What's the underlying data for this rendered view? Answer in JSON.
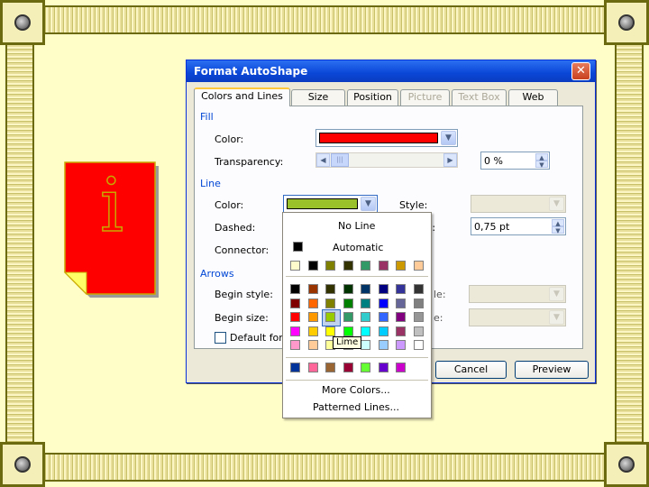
{
  "dialog": {
    "title": "Format AutoShape",
    "close_glyph": "✕",
    "tabs": [
      {
        "label": "Colors and Lines",
        "state": "active"
      },
      {
        "label": "Size",
        "state": "normal"
      },
      {
        "label": "Position",
        "state": "normal"
      },
      {
        "label": "Picture",
        "state": "disabled"
      },
      {
        "label": "Text Box",
        "state": "disabled"
      },
      {
        "label": "Web",
        "state": "normal"
      }
    ],
    "fill": {
      "section": "Fill",
      "color_label": "Color:",
      "color_value": "#ff0000",
      "transparency_label": "Transparency:",
      "transparency_value": "0 %"
    },
    "line": {
      "section": "Line",
      "color_label": "Color:",
      "color_value": "#9ac02a",
      "dashed_label": "Dashed:",
      "connector_label": "Connector:",
      "style_label": "Style:",
      "weight_label_tail": "t:",
      "weight_value": "0,75 pt"
    },
    "arrows": {
      "section": "Arrows",
      "begin_style_label": "Begin style:",
      "begin_size_label": "Begin size:",
      "end_style_tail": "le:",
      "end_size_tail": "e:"
    },
    "default_label": "Default for",
    "cancel_label": "Cancel",
    "preview_label": "Preview"
  },
  "color_menu": {
    "no_line": "No Line",
    "automatic": "Automatic",
    "more_colors": "More Colors...",
    "patterned_lines": "Patterned Lines...",
    "tooltip": "Lime",
    "recent_colors": [
      "#fffbcc",
      "#000000",
      "#808000",
      "#333300",
      "#339966",
      "#993366",
      "#cc9900",
      "#ffcc99"
    ],
    "standard_colors": [
      [
        "#000000",
        "#993300",
        "#333300",
        "#003300",
        "#003366",
        "#000080",
        "#333399",
        "#333333"
      ],
      [
        "#800000",
        "#ff6600",
        "#808000",
        "#008000",
        "#008080",
        "#0000ff",
        "#666699",
        "#808080"
      ],
      [
        "#ff0000",
        "#ff9900",
        "#99cc00",
        "#339966",
        "#33cccc",
        "#3366ff",
        "#800080",
        "#969696"
      ],
      [
        "#ff00ff",
        "#ffcc00",
        "#ffff00",
        "#00ff00",
        "#00ffff",
        "#00ccff",
        "#993366",
        "#c0c0c0"
      ],
      [
        "#ff99cc",
        "#ffcc99",
        "#ffff99",
        "#ccffcc",
        "#ccffff",
        "#99ccff",
        "#cc99ff",
        "#ffffff"
      ]
    ],
    "custom_colors": [
      "#003399",
      "#ff6699",
      "#996633",
      "#990033",
      "#66ff33",
      "#6600cc",
      "#cc00cc"
    ]
  },
  "info_icon": {
    "glyph": "i",
    "fill": "#ff0000",
    "outline": "#c8a800"
  }
}
